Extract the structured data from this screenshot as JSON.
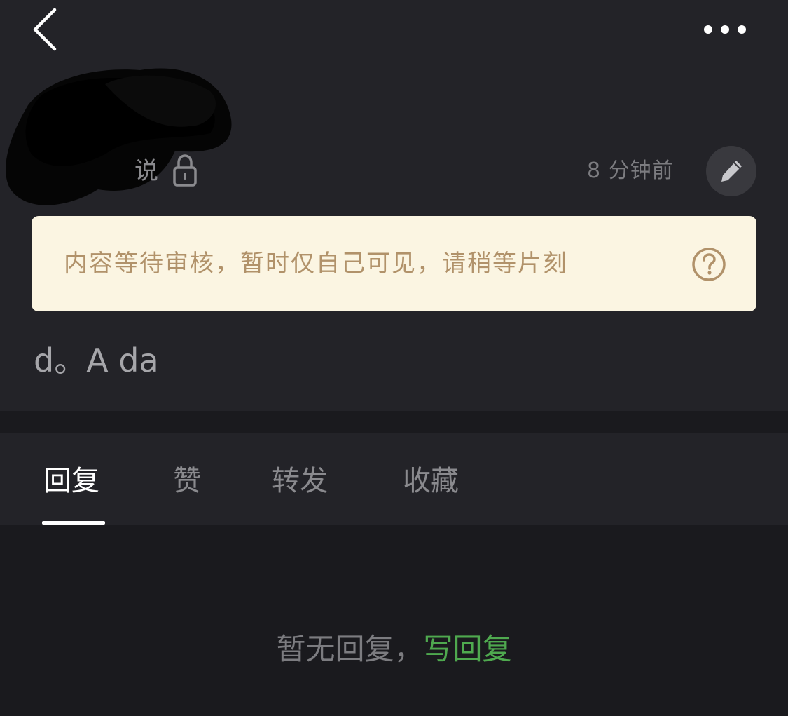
{
  "nav": {
    "back_icon": "chevron-left-icon",
    "more_icon": "more-horizontal-icon"
  },
  "post": {
    "author_suffix": "说",
    "privacy_icon": "lock-icon",
    "time": "8 分钟前",
    "edit_icon": "pencil-icon",
    "content": "d。A da"
  },
  "notice": {
    "text": "内容等待审核，暂时仅自己可见，请稍等片刻",
    "help_icon": "question-circle-icon",
    "background": "#fbf5e2",
    "text_color": "#b1926a"
  },
  "tabs": [
    {
      "label": "回复",
      "active": true
    },
    {
      "label": "赞",
      "active": false
    },
    {
      "label": "转发",
      "active": false
    },
    {
      "label": "收藏",
      "active": false
    }
  ],
  "empty_state": {
    "message": "暂无回复，",
    "action_label": "写回复",
    "action_color": "#4fa94f"
  }
}
